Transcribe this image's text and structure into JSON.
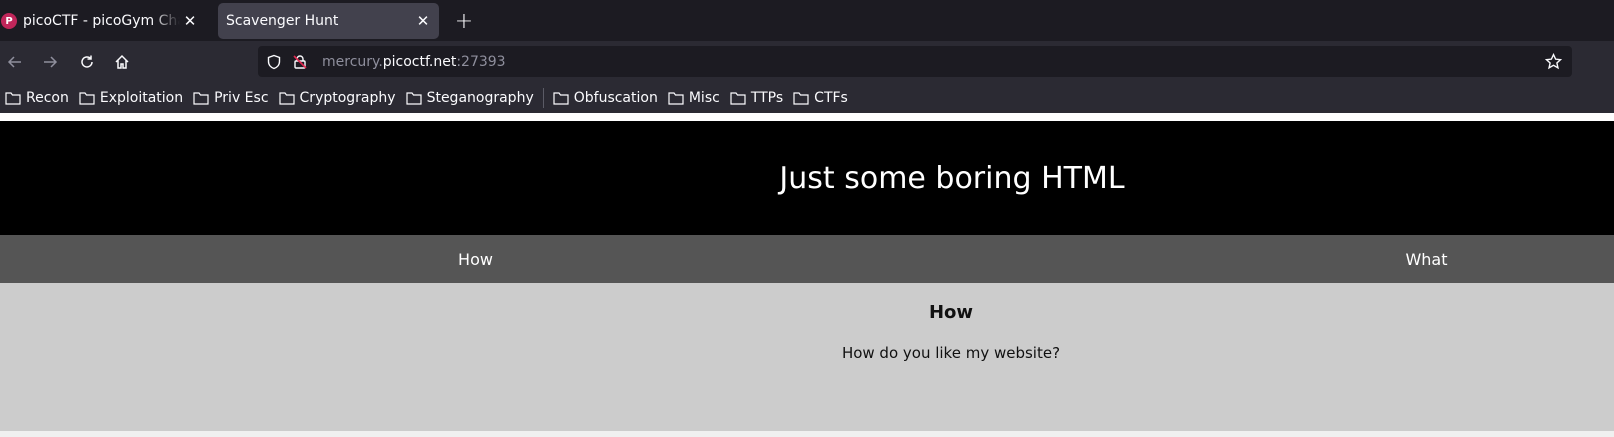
{
  "browser": {
    "tabs": [
      {
        "title": "picoCTF - picoGym Challe",
        "favicon": "P",
        "active": false
      },
      {
        "title": "Scavenger Hunt",
        "active": true
      }
    ],
    "new_tab_icon": "plus-icon",
    "url": {
      "prefix": "mercury.",
      "host": "picoctf.net",
      "port": ":27393"
    },
    "bookmarks": [
      "Recon",
      "Exploitation",
      "Priv Esc",
      "Cryptography",
      "Steganography",
      "Obfuscation",
      "Misc",
      "TTPs",
      "CTFs"
    ]
  },
  "page": {
    "header_title": "Just some boring HTML",
    "tabs": {
      "how": "How",
      "what": "What"
    },
    "content": {
      "heading": "How",
      "text": "How do you like my website?"
    }
  },
  "colors": {
    "tabbar_bg": "#1c1b22",
    "toolbar_bg": "#2b2a33",
    "header_bg": "#000000",
    "nav_bg": "#555555",
    "content_bg": "#cccccc"
  }
}
